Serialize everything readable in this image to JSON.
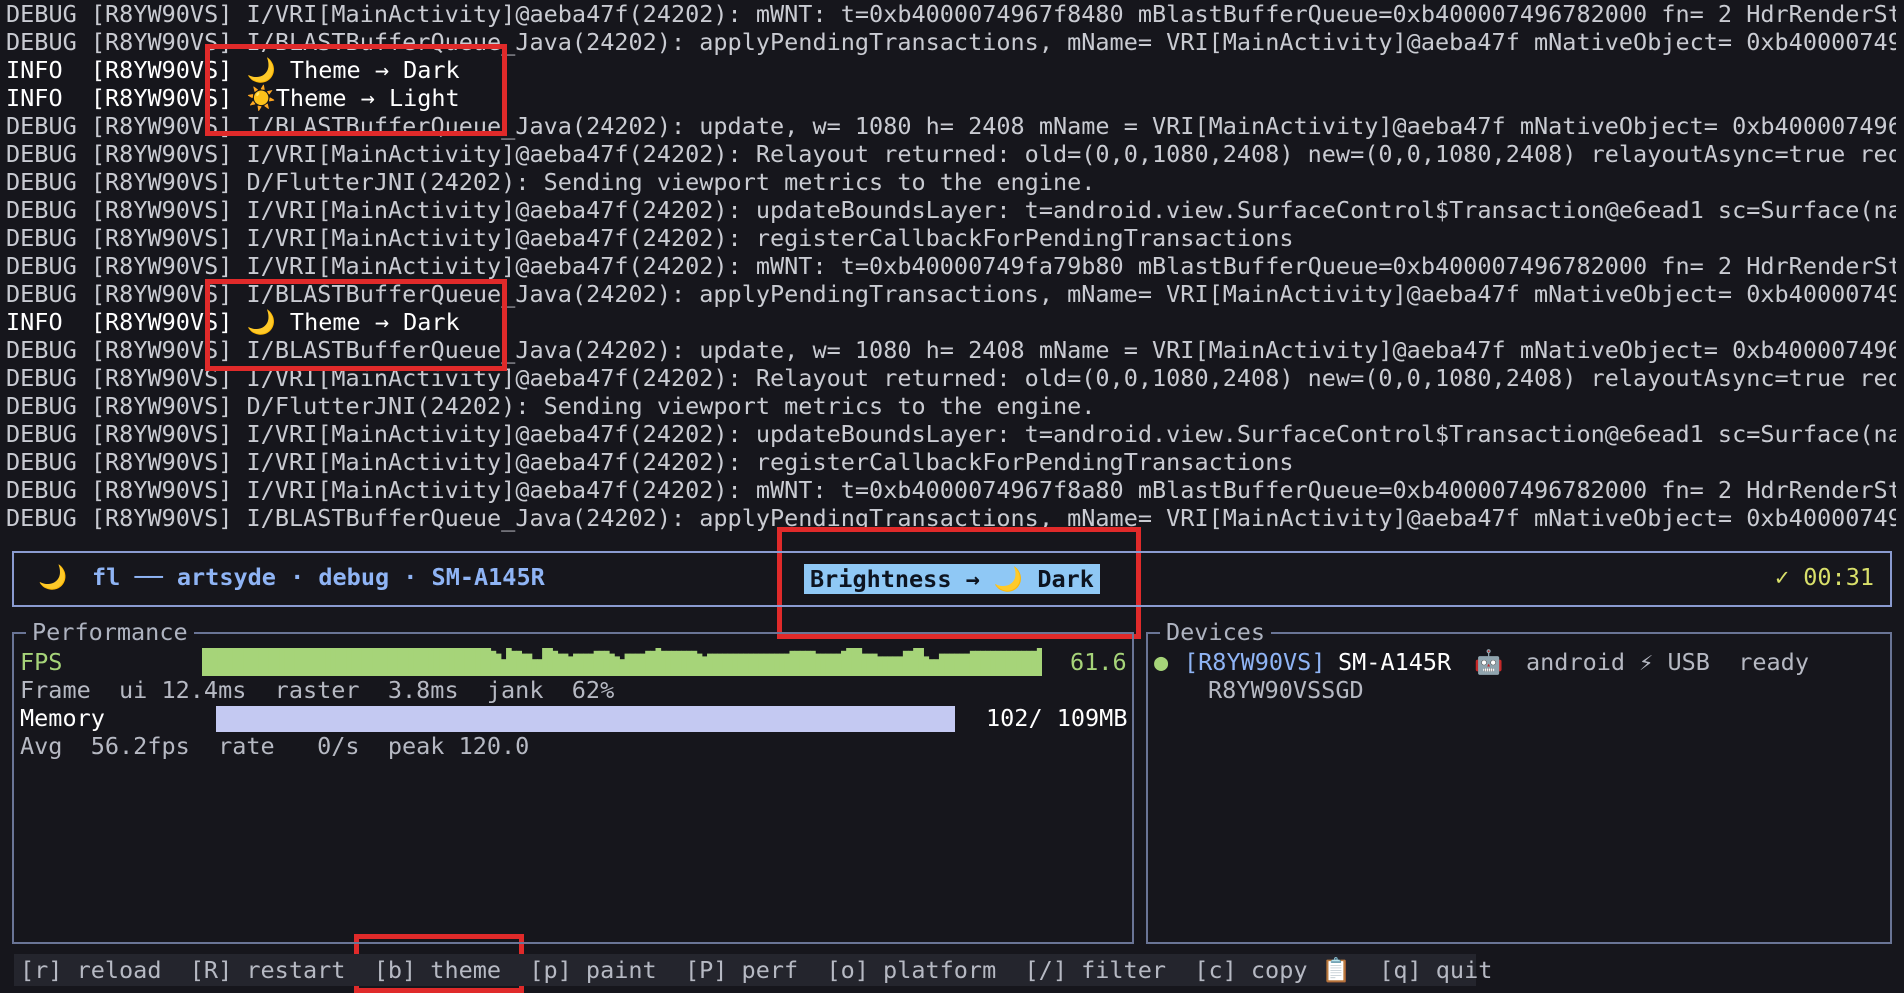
{
  "log_lines": [
    {
      "level": "DEBUG",
      "text": "DEBUG [R8YW90VS] I/VRI[MainActivity]@aeba47f(24202): mWNT: t=0xb4000074967f8480 mBlastBufferQueue=0xb400007496782000 fn= 2 HdrRenderSta"
    },
    {
      "level": "DEBUG",
      "text": "DEBUG [R8YW90VS] I/BLASTBufferQueue_Java(24202): applyPendingTransactions, mName= VRI[MainActivity]@aeba47f mNativeObject= 0xb400007496"
    },
    {
      "level": "INFO",
      "text": "INFO  [R8YW90VS] 🌙 Theme → Dark"
    },
    {
      "level": "INFO",
      "text": "INFO  [R8YW90VS] ☀️Theme → Light"
    },
    {
      "level": "DEBUG",
      "text": "DEBUG [R8YW90VS] I/BLASTBufferQueue_Java(24202): update, w= 1080 h= 2408 mName = VRI[MainActivity]@aeba47f mNativeObject= 0xb4000074967"
    },
    {
      "level": "DEBUG",
      "text": "DEBUG [R8YW90VS] I/VRI[MainActivity]@aeba47f(24202): Relayout returned: old=(0,0,1080,2408) new=(0,0,1080,2408) relayoutAsync=true req="
    },
    {
      "level": "DEBUG",
      "text": "DEBUG [R8YW90VS] D/FlutterJNI(24202): Sending viewport metrics to the engine."
    },
    {
      "level": "DEBUG",
      "text": "DEBUG [R8YW90VS] I/VRI[MainActivity]@aeba47f(24202): updateBoundsLayer: t=android.view.SurfaceControl$Transaction@e6ead1 sc=Surface(nam"
    },
    {
      "level": "DEBUG",
      "text": "DEBUG [R8YW90VS] I/VRI[MainActivity]@aeba47f(24202): registerCallbackForPendingTransactions"
    },
    {
      "level": "DEBUG",
      "text": "DEBUG [R8YW90VS] I/VRI[MainActivity]@aeba47f(24202): mWNT: t=0xb40000749fa79b80 mBlastBufferQueue=0xb400007496782000 fn= 2 HdrRenderSta"
    },
    {
      "level": "DEBUG",
      "text": "DEBUG [R8YW90VS] I/BLASTBufferQueue_Java(24202): applyPendingTransactions, mName= VRI[MainActivity]@aeba47f mNativeObject= 0xb400007496"
    },
    {
      "level": "INFO",
      "text": "INFO  [R8YW90VS] 🌙 Theme → Dark"
    },
    {
      "level": "DEBUG",
      "text": "DEBUG [R8YW90VS] I/BLASTBufferQueue_Java(24202): update, w= 1080 h= 2408 mName = VRI[MainActivity]@aeba47f mNativeObject= 0xb4000074967"
    },
    {
      "level": "DEBUG",
      "text": "DEBUG [R8YW90VS] I/VRI[MainActivity]@aeba47f(24202): Relayout returned: old=(0,0,1080,2408) new=(0,0,1080,2408) relayoutAsync=true req="
    },
    {
      "level": "DEBUG",
      "text": "DEBUG [R8YW90VS] D/FlutterJNI(24202): Sending viewport metrics to the engine."
    },
    {
      "level": "DEBUG",
      "text": "DEBUG [R8YW90VS] I/VRI[MainActivity]@aeba47f(24202): updateBoundsLayer: t=android.view.SurfaceControl$Transaction@e6ead1 sc=Surface(nam"
    },
    {
      "level": "DEBUG",
      "text": "DEBUG [R8YW90VS] I/VRI[MainActivity]@aeba47f(24202): registerCallbackForPendingTransactions"
    },
    {
      "level": "DEBUG",
      "text": "DEBUG [R8YW90VS] I/VRI[MainActivity]@aeba47f(24202): mWNT: t=0xb4000074967f8a80 mBlastBufferQueue=0xb400007496782000 fn= 2 HdrRenderSta"
    },
    {
      "level": "DEBUG",
      "text": "DEBUG [R8YW90VS] I/BLASTBufferQueue_Java(24202): applyPendingTransactions, mName= VRI[MainActivity]@aeba47f mNativeObject= 0xb400007496"
    }
  ],
  "status": {
    "icon": "🌙",
    "title": "fl ── artsyde · debug · SM-A145R",
    "pill": "Brightness → 🌙 Dark",
    "timer": "✓ 00:31"
  },
  "performance": {
    "title": "Performance",
    "fps_label": "FPS",
    "fps_value": "61.6",
    "fps_history": [
      10,
      10,
      10,
      10,
      10,
      10,
      10,
      10,
      10,
      10,
      10,
      10,
      10,
      10,
      10,
      10,
      10,
      10,
      10,
      10,
      10,
      10,
      10,
      10,
      10,
      10,
      10,
      10,
      10,
      10,
      10,
      10,
      10,
      10,
      10,
      10,
      10,
      10,
      10,
      10,
      10,
      10,
      10,
      10,
      10,
      10,
      10,
      10,
      10,
      10,
      10,
      10,
      10,
      10,
      10,
      10,
      9,
      8,
      6,
      10,
      9,
      9,
      8,
      8,
      6,
      6,
      10,
      10,
      9,
      8,
      8,
      7,
      8,
      8,
      8,
      8,
      9,
      9,
      9,
      8,
      7,
      6,
      8,
      8,
      8,
      8,
      9,
      9,
      10,
      9,
      9,
      9,
      9,
      9,
      9,
      9,
      8,
      7,
      8,
      8,
      8,
      8,
      8,
      8,
      8,
      8,
      8,
      8,
      8,
      8,
      8,
      8,
      8,
      8,
      9,
      9,
      9,
      9,
      9,
      8,
      8,
      8,
      8,
      8,
      9,
      10,
      10,
      10,
      8,
      8,
      8,
      7,
      7,
      7,
      7,
      7,
      9,
      9,
      10,
      10,
      7,
      6,
      6,
      8,
      8,
      8,
      8,
      8,
      8,
      9,
      9,
      9,
      9,
      9,
      9,
      9,
      9,
      9,
      9,
      9,
      9,
      9,
      10
    ],
    "frame_line": "Frame  ui 12.4ms  raster  3.8ms  jank  62%",
    "memory_label": "Memory",
    "memory_fraction": 0.936,
    "memory_value": "102/ 109MB",
    "avg_line": "Avg  56.2fps  rate   0/s  peak 120.0"
  },
  "devices": {
    "title": "Devices",
    "items": [
      {
        "dot": "●",
        "id": "[R8YW90VS]",
        "name": "SM-A145R",
        "robot": "🤖",
        "platform": "android ⚡ USB  ready",
        "serial": "R8YW90VSSGD"
      }
    ]
  },
  "keys": "[r] reload  [R] restart  [b] theme  [p] paint  [P] perf  [o] platform  [/] filter  [c] copy 📋  [q] quit",
  "colors": {
    "fps": "#a6d479",
    "memory": "#c4c9f2",
    "accent": "#8fb4f5",
    "highlight": "#e02a2a"
  }
}
